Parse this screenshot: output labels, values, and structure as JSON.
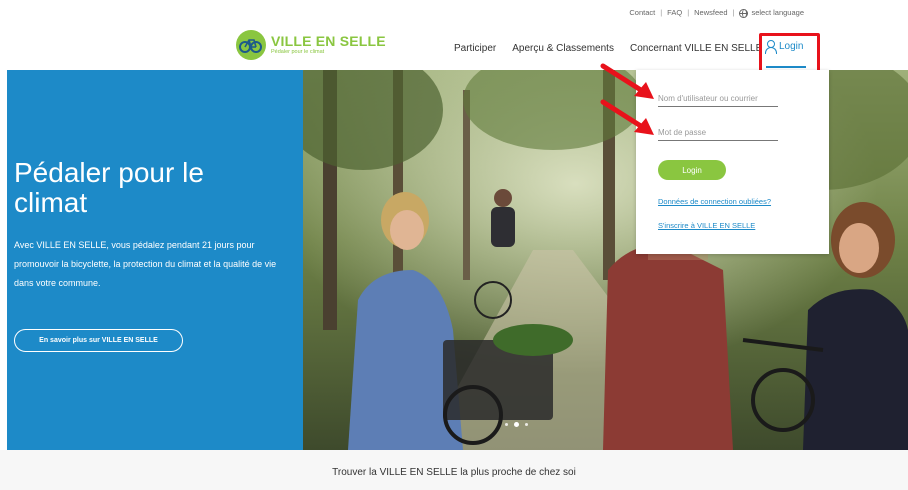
{
  "topbar": {
    "contact": "Contact",
    "faq": "FAQ",
    "newsfeed": "Newsfeed",
    "language": "select language",
    "separator": "|"
  },
  "logo": {
    "name": "VILLE EN SELLE",
    "tagline": "Pédaler pour le climat"
  },
  "nav": {
    "items": [
      "Participer",
      "Aperçu & Classements",
      "Concernant VILLE EN SELLE"
    ],
    "login": "Login"
  },
  "hero": {
    "title": "Pédaler pour le climat",
    "text": "Avec VILLE EN SELLE, vous pédalez pendant 21 jours pour promouvoir la bicyclette, la protection du climat et la qualité de vie dans votre commune.",
    "button": "En savoir plus sur VILLE EN SELLE"
  },
  "login_form": {
    "username_placeholder": "Nom d'utilisateur ou courrier",
    "password_placeholder": "Mot de passe",
    "submit": "Login",
    "forgot": "Données de connection oubliées?",
    "signup": "S'inscrire à VILLE EN SELLE"
  },
  "footer_strip": {
    "text": "Trouver la VILLE EN SELLE la plus proche de chez soi"
  },
  "colors": {
    "brand_green": "#8ac640",
    "brand_blue": "#1d8ac8",
    "annotation_red": "#e8121b"
  },
  "icons": {
    "logo": "bicycle-icon",
    "language": "globe-icon",
    "login": "user-icon"
  }
}
